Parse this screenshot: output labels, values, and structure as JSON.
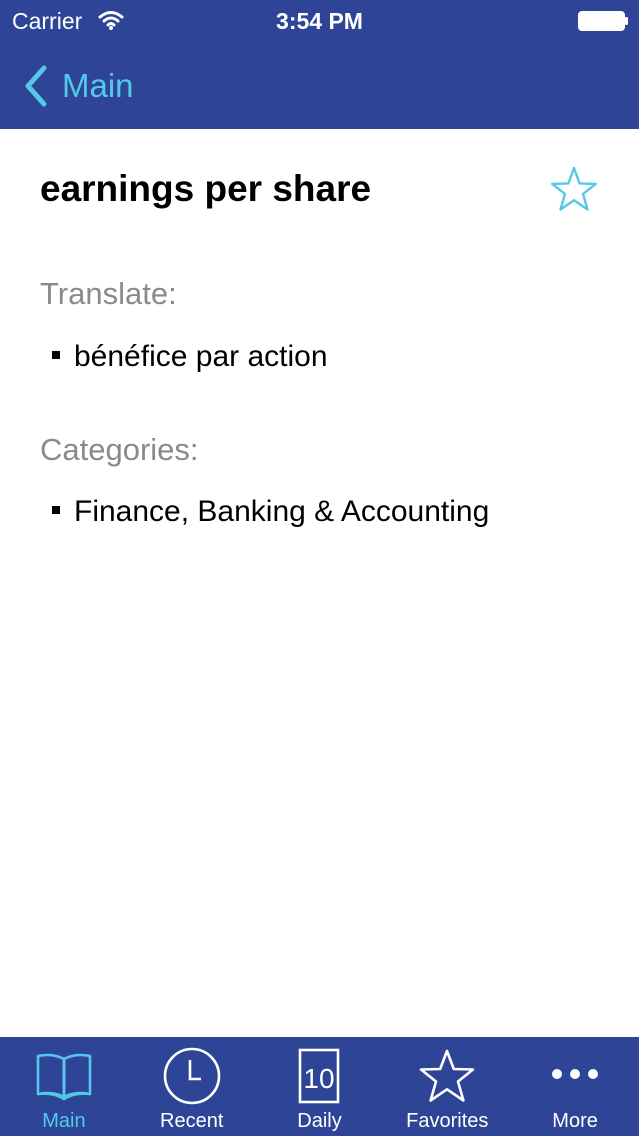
{
  "status_bar": {
    "carrier": "Carrier",
    "time": "3:54 PM",
    "wifi_icon": "wifi-icon",
    "battery_icon": "battery-icon"
  },
  "nav": {
    "back_label": "Main",
    "back_icon": "chevron-left-icon"
  },
  "term": {
    "title": "earnings per share",
    "favorite_icon": "star-outline-icon"
  },
  "translate": {
    "label": "Translate:",
    "items": [
      "bénéfice par action"
    ]
  },
  "categories": {
    "label": "Categories:",
    "items": [
      "Finance, Banking & Accounting"
    ]
  },
  "tab_bar": {
    "active_index": 0,
    "tabs": [
      {
        "label": "Main",
        "icon": "book-icon"
      },
      {
        "label": "Recent",
        "icon": "clock-icon"
      },
      {
        "label": "Daily",
        "icon": "calendar-icon",
        "icon_text": "10"
      },
      {
        "label": "Favorites",
        "icon": "star-icon"
      },
      {
        "label": "More",
        "icon": "more-icon"
      }
    ]
  },
  "colors": {
    "bar_background": "#2e4597",
    "accent": "#55c8e8",
    "section_label": "#8a8a8e",
    "text": "#000000",
    "background": "#ffffff"
  }
}
